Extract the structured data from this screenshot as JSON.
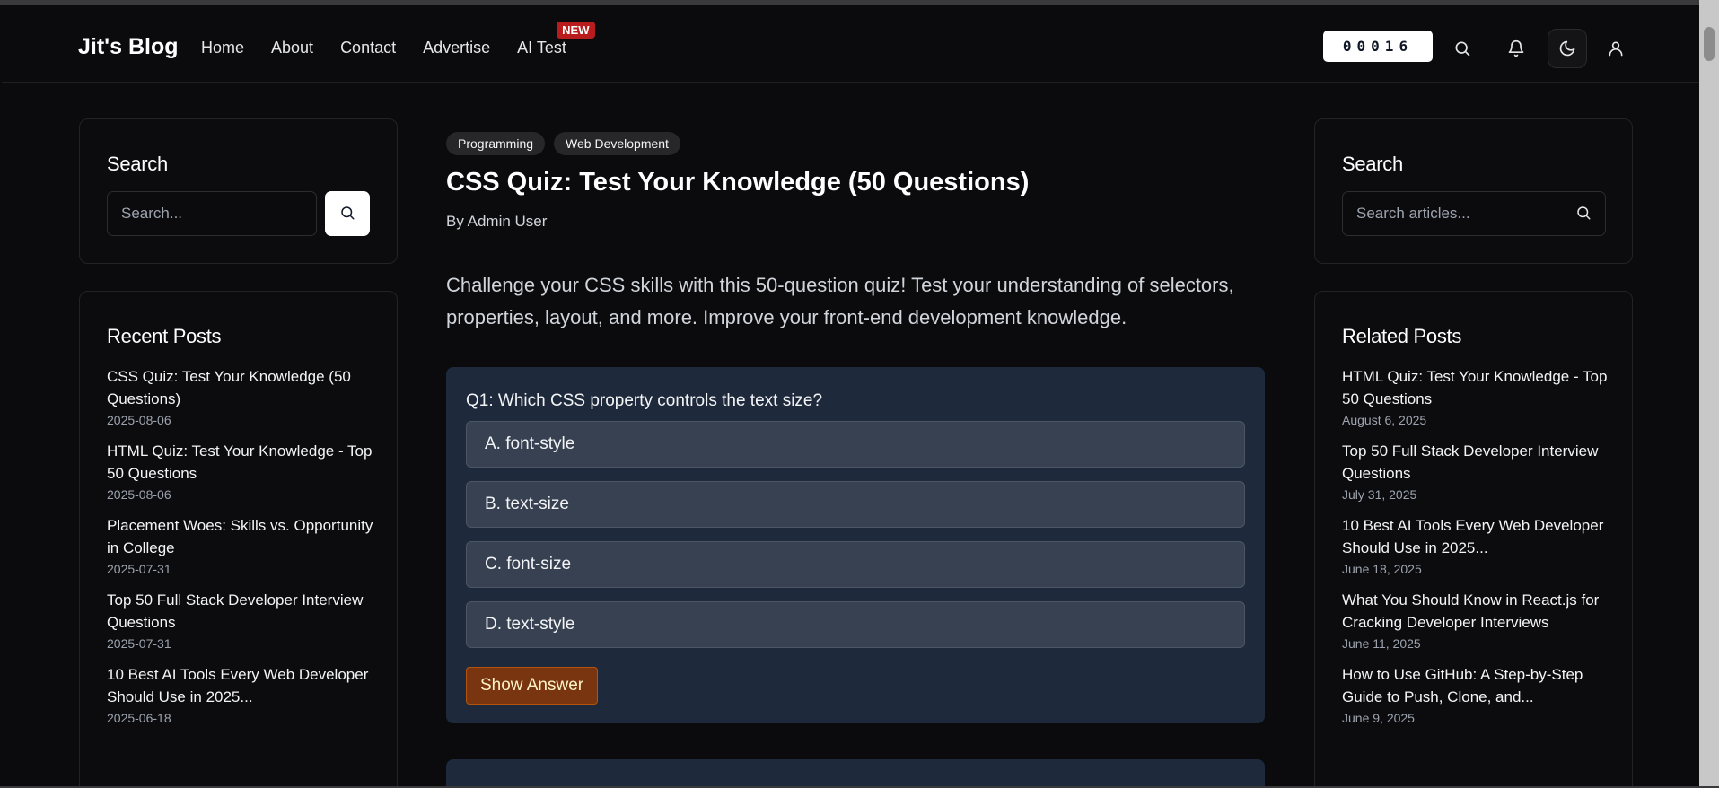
{
  "header": {
    "brand": "Jit's Blog",
    "nav": [
      {
        "label": "Home"
      },
      {
        "label": "About"
      },
      {
        "label": "Contact"
      },
      {
        "label": "Advertise"
      },
      {
        "label": "AI Test",
        "badge": "NEW"
      }
    ],
    "visitor_counter": "00016",
    "icons": [
      "search-icon",
      "bell-icon",
      "moon-icon",
      "user-icon"
    ]
  },
  "left_sidebar": {
    "search": {
      "title": "Search",
      "placeholder": "Search..."
    },
    "recent": {
      "title": "Recent Posts",
      "items": [
        {
          "title": "CSS Quiz: Test Your Knowledge (50 Questions)",
          "date": "2025-08-06"
        },
        {
          "title": "HTML Quiz: Test Your Knowledge - Top 50 Questions",
          "date": "2025-08-06"
        },
        {
          "title": "Placement Woes: Skills vs. Opportunity in College",
          "date": "2025-07-31"
        },
        {
          "title": "Top 50 Full Stack Developer Interview Questions",
          "date": "2025-07-31"
        },
        {
          "title": "10 Best AI Tools Every Web Developer Should Use in 2025...",
          "date": "2025-06-18"
        }
      ]
    }
  },
  "main": {
    "tags": [
      "Programming",
      "Web Development"
    ],
    "title": "CSS Quiz: Test Your Knowledge (50 Questions)",
    "author": "By Admin User",
    "intro": "Challenge your CSS skills with this 50-question quiz! Test your understanding of selectors, properties, layout, and more. Improve your front-end development knowledge.",
    "quiz": {
      "question": "Q1: Which CSS property controls the text size?",
      "options": [
        "A. font-style",
        "B. text-size",
        "C. font-size",
        "D. text-style"
      ],
      "show_answer_label": "Show Answer"
    }
  },
  "right_sidebar": {
    "search": {
      "title": "Search",
      "placeholder": "Search articles..."
    },
    "related": {
      "title": "Related Posts",
      "items": [
        {
          "title": "HTML Quiz: Test Your Knowledge - Top 50 Questions",
          "date": "August 6, 2025"
        },
        {
          "title": "Top 50 Full Stack Developer Interview Questions",
          "date": "July 31, 2025"
        },
        {
          "title": "10 Best AI Tools Every Web Developer Should Use in 2025...",
          "date": "June 18, 2025"
        },
        {
          "title": "What You Should Know in React.js for Cracking Developer Interviews",
          "date": "June 11, 2025"
        },
        {
          "title": "How to Use GitHub: A Step-by-Step Guide to Push, Clone, and...",
          "date": "June 9, 2025"
        }
      ]
    }
  },
  "colors": {
    "background": "#0b0b0d",
    "quiz_card": "#1e293b",
    "option_bg": "#374151",
    "show_answer_bg": "#78350f",
    "new_badge": "#b91c1c"
  }
}
